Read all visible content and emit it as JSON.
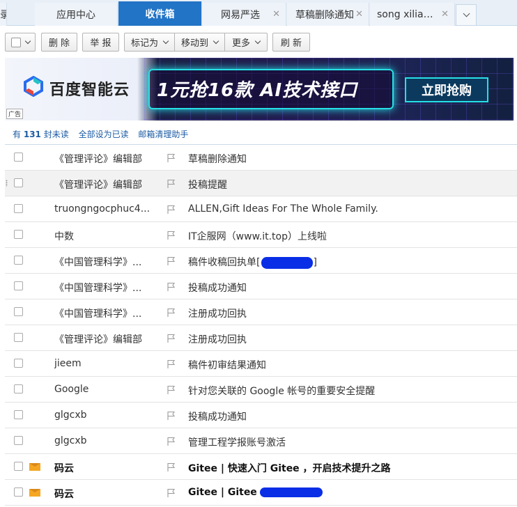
{
  "tabs": [
    {
      "label": "录",
      "active": false,
      "closable": false
    },
    {
      "label": "应用中心",
      "active": false,
      "closable": false
    },
    {
      "label": "收件箱",
      "active": true,
      "closable": false
    },
    {
      "label": "网易严选",
      "active": false,
      "closable": true
    },
    {
      "label": "草稿删除通知",
      "active": false,
      "closable": true
    },
    {
      "label": "song xilian…",
      "active": false,
      "closable": true
    }
  ],
  "toolbar": {
    "delete_label": "删 除",
    "report_label": "举 报",
    "mark_label": "标记为",
    "move_label": "移动到",
    "more_label": "更多",
    "refresh_label": "刷 新"
  },
  "ad": {
    "brand": "百度智能云",
    "slogan": "1元抢16款 AI技术接口",
    "cta": "立即抢购",
    "tag": "广告"
  },
  "unread": {
    "prefix": "有",
    "count": "131",
    "suffix": "封未读",
    "mark_all": "全部设为已读",
    "cleanup": "邮箱清理助手"
  },
  "mails": [
    {
      "sender": "《管理评论》编辑部",
      "subject": "草稿删除通知",
      "unread": false
    },
    {
      "sender": "《管理评论》编辑部",
      "subject": "投稿提醒",
      "unread": false
    },
    {
      "sender": "truongngocphuc4...",
      "subject": "ALLEN,Gift Ideas For The Whole Family.",
      "unread": false
    },
    {
      "sender": "中数",
      "subject": "IT企服网（www.it.top）上线啦",
      "unread": false
    },
    {
      "sender": "《中国管理科学》...",
      "subject": "稿件收稿回执单[",
      "subject_tail": "]",
      "unread": false
    },
    {
      "sender": "《中国管理科学》...",
      "subject": "投稿成功通知",
      "unread": false
    },
    {
      "sender": "《中国管理科学》...",
      "subject": "注册成功回执",
      "unread": false
    },
    {
      "sender": "《管理评论》编辑部",
      "subject": "注册成功回执",
      "unread": false
    },
    {
      "sender": "jieem",
      "subject": "稿件初审结果通知",
      "unread": false
    },
    {
      "sender": "Google",
      "subject": "针对您关联的 Google 帐号的重要安全提醒",
      "unread": false
    },
    {
      "sender": "glgcxb",
      "subject": "投稿成功通知",
      "unread": false
    },
    {
      "sender": "glgcxb",
      "subject": "管理工程学报账号激活",
      "unread": false
    },
    {
      "sender": "码云",
      "subject": "Gitee | 快速入门 Gitee ，开启技术提升之路",
      "unread": true
    },
    {
      "sender": "码云",
      "subject": "Gitee | Gitee",
      "unread": true
    }
  ],
  "colors": {
    "tab_active": "#2274c6",
    "link": "#1b5ba3",
    "unread_icon": "#f5a623"
  }
}
